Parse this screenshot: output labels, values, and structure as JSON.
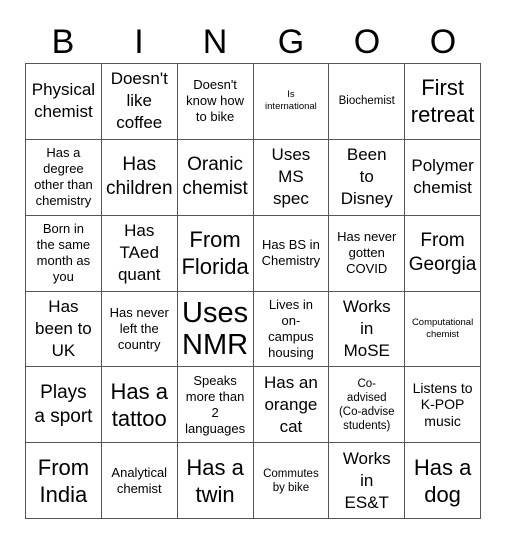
{
  "header": {
    "letters": [
      "B",
      "I",
      "N",
      "G",
      "O",
      "O"
    ]
  },
  "board": {
    "rows": [
      [
        "Physical\nchemist",
        "Doesn't\nlike\ncoffee",
        "Doesn't\nknow how\nto bike",
        "Is\ninternational",
        "Biochemist",
        "First\nretreat"
      ],
      [
        "Has a\ndegree\nother than\nchemistry",
        "Has\nchildren",
        "Oranic\nchemist",
        "Uses\nMS\nspec",
        "Been\nto\nDisney",
        "Polymer\nchemist"
      ],
      [
        "Born in\nthe same\nmonth as\nyou",
        "Has\nTAed\nquant",
        "From\nFlorida",
        "Has BS in\nChemistry",
        "Has never\ngotten\nCOVID",
        "From\nGeorgia"
      ],
      [
        "Has\nbeen to\nUK",
        "Has never\nleft the\ncountry",
        "Uses\nNMR",
        "Lives in\non-\ncampus\nhousing",
        "Works\nin\nMoSE",
        "Computational\nchemist"
      ],
      [
        "Plays\na sport",
        "Has a\ntattoo",
        "Speaks\nmore than\n2\nlanguages",
        "Has an\norange\ncat",
        "Co-\nadvised\n(Co-advise\nstudents)",
        "Listens to\nK-POP\nmusic"
      ],
      [
        "From\nIndia",
        "Analytical\nchemist",
        "Has a\ntwin",
        "Commutes\nby bike",
        "Works\nin\nES&T",
        "Has a\ndog"
      ]
    ]
  }
}
